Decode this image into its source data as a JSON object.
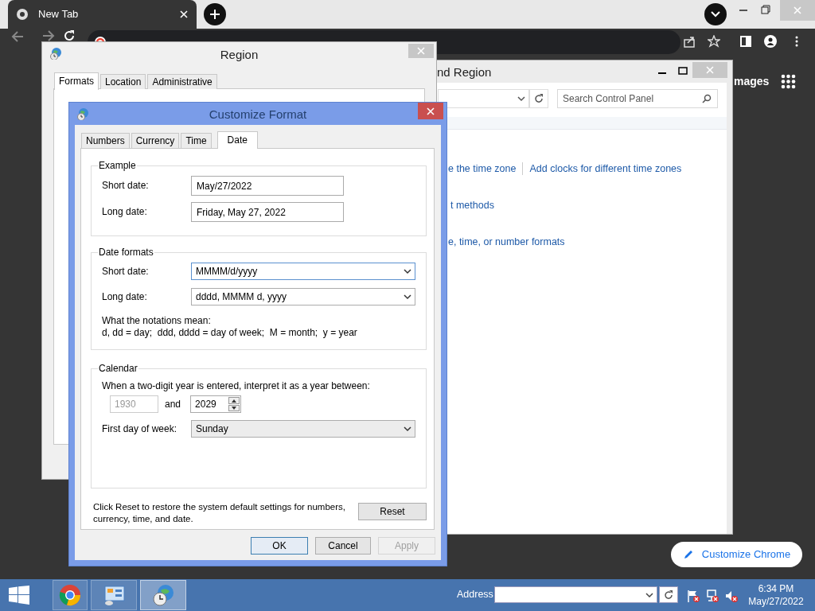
{
  "browser": {
    "tab": {
      "title": "New Tab"
    },
    "page_text": "mages",
    "customize_button": "Customize Chrome"
  },
  "control_panel": {
    "title": "nd Region",
    "search": {
      "placeholder": "Search Control Panel"
    },
    "link_rows": [
      [
        "e the time zone",
        "Add clocks for different time zones"
      ],
      [
        "t methods"
      ],
      [
        "e, time, or number formats"
      ]
    ]
  },
  "region": {
    "title": "Region",
    "tabs": [
      {
        "label": "Formats",
        "selected": true
      },
      {
        "label": "Location",
        "selected": false
      },
      {
        "label": "Administrative",
        "selected": false
      }
    ]
  },
  "customize": {
    "title": "Customize Format",
    "tabs": [
      {
        "label": "Numbers",
        "selected": false
      },
      {
        "label": "Currency",
        "selected": false
      },
      {
        "label": "Time",
        "selected": false
      },
      {
        "label": "Date",
        "selected": true
      }
    ],
    "example": {
      "legend": "Example",
      "rows": [
        {
          "label": "Short date:",
          "value": "May/27/2022"
        },
        {
          "label": "Long date:",
          "value": "Friday, May 27, 2022"
        }
      ]
    },
    "date_formats": {
      "legend": "Date formats",
      "rows": [
        {
          "label": "Short date:",
          "value": "MMMM/d/yyyy",
          "focused": true
        },
        {
          "label": "Long date:",
          "value": "dddd, MMMM d, yyyy",
          "focused": false
        }
      ],
      "notes": [
        "What the notations mean:",
        "d, dd = day;  ddd, dddd = day of week;  M = month;  y = year"
      ]
    },
    "calendar": {
      "legend": "Calendar",
      "prompt": "When a two-digit year is entered, interpret it as a year between:",
      "from_year": {
        "value": "1930",
        "disabled": true
      },
      "joiner": "and",
      "to_year": "2029",
      "first_day": {
        "label": "First day of week:",
        "value": "Sunday"
      }
    },
    "reset_note": "Click Reset to restore the system default settings for numbers, currency, time, and date.",
    "reset_button": "Reset",
    "buttons": [
      {
        "label": "OK",
        "default": true,
        "disabled": false
      },
      {
        "label": "Cancel",
        "default": false,
        "disabled": false
      },
      {
        "label": "Apply",
        "default": false,
        "disabled": true
      }
    ]
  },
  "taskbar": {
    "apps": [
      {
        "kind": "chrome",
        "selected": false
      },
      {
        "kind": "control-panel",
        "selected": false
      },
      {
        "kind": "region",
        "selected": true
      }
    ],
    "address_label": "Address",
    "clock": {
      "time": "6:34 PM",
      "date": "May/27/2022"
    }
  }
}
